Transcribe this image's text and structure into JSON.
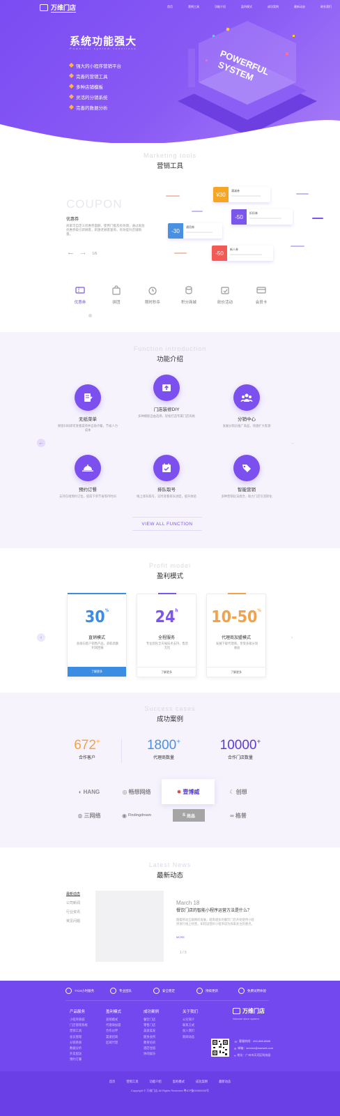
{
  "brand": {
    "name": "万维门店"
  },
  "nav": [
    "首页",
    "营销工具",
    "功能介绍",
    "盈利模式",
    "成功案例",
    "最新动态",
    "联系我们"
  ],
  "hero": {
    "title": "系统功能强大",
    "subtitle": "Powerful system functions",
    "features": [
      "强大的小程序营销平台",
      "完善的营销工具",
      "多种店铺模板",
      "灵活的分销系统",
      "完善的数据分析"
    ],
    "badge_line1": "POWERFUL",
    "badge_line2": "SYSTEM"
  },
  "marketing": {
    "en": "Marketing tools",
    "cn": "营销工具",
    "big": "COUPON",
    "name": "优惠券",
    "desc": "商家可自定义优惠券面额、使用门槛及有效期，通过发放优惠券吸引新顾客，刺激老顾客复购，有效提升店铺销量。",
    "pager": "1/6",
    "tickets": [
      {
        "value": "¥30",
        "label": "满减券",
        "color": "#f6a623"
      },
      {
        "value": "-50",
        "label": "折扣券",
        "color": "#7b55ec"
      },
      {
        "value": "-30",
        "label": "通用券",
        "color": "#4a90e2"
      },
      {
        "value": "-50",
        "label": "新人券",
        "color": "#f25a55"
      }
    ],
    "tabs": [
      "优惠券",
      "拼团",
      "限时秒杀",
      "积分商城",
      "砍价活动",
      "会员卡"
    ],
    "active_tab": 0
  },
  "functions": {
    "en": "Function introduction",
    "cn": "功能介绍",
    "items": [
      {
        "title": "无纸菜单",
        "desc": "顾客扫码即可查看菜单并自助点餐，节省人力成本"
      },
      {
        "title": "门店装修DIY",
        "desc": "多种模板自由选择，轻松打造专属门店风格"
      },
      {
        "title": "分销中心",
        "desc": "发展分销员推广商品，快速扩大客源"
      },
      {
        "title": "预约订餐",
        "desc": "支持在线预约订位，提前下单节省等待时间"
      },
      {
        "title": "排队取号",
        "desc": "线上排队取号，实时查看排队进度，提升体验"
      },
      {
        "title": "智能营销",
        "desc": "多种营销玩法组合，助力门店引流转化"
      }
    ],
    "view_all": "VIEW ALL FUNCTION"
  },
  "profit": {
    "en": "Profit model",
    "cn": "盈利模式",
    "cards": [
      {
        "num": "30",
        "sup": "%",
        "title": "直销模式",
        "desc": "直接向客户销售产品，获取高额利润回报",
        "btn": "了解更多",
        "color": "#3b8ce3"
      },
      {
        "num": "24",
        "sup": "h",
        "title": "全程服务",
        "desc": "专业团队全天候技术支持，售后无忧",
        "btn": "了解更多",
        "color": "#7b55ec"
      },
      {
        "num": "10-50",
        "sup": "%",
        "title": "代理商加盟模式",
        "desc": "发展下级代理商，享受多级分润收益",
        "btn": "了解更多",
        "color": "#f5a14a"
      }
    ]
  },
  "cases": {
    "en": "Success cases",
    "cn": "成功案例",
    "stats": [
      {
        "num": "672",
        "plus": "+",
        "label": "合作客户",
        "color": "#f5a14a"
      },
      {
        "num": "1800",
        "plus": "+",
        "label": "代理商数量",
        "color": "#4a90e2"
      },
      {
        "num": "10000",
        "plus": "+",
        "label": "合作门店数量",
        "color": "#5a3bd8"
      }
    ],
    "brands": [
      "HANG",
      "畅想网络",
      "壹博威",
      "创想",
      "三网络",
      "Findingdream",
      "尚品",
      "格普"
    ]
  },
  "news": {
    "en": "Latest News",
    "cn": "最新动态",
    "tabs": [
      "最新动态",
      "公司新闻",
      "行业资讯",
      "常见问题"
    ],
    "date": "March 18",
    "title": "餐饮门店的智能小程序运营方法是什么？",
    "body": "随着移动互联网的发展，越来越多的餐饮门店开始使用小程序进行线上经营，如何运营好小程序成为商家关注的重点。",
    "more": "MORE",
    "pager": "1 / 5"
  },
  "footer": {
    "features": [
      "7×24小时服务",
      "专业团队",
      "安全稳定",
      "持续更新",
      "免费试用体验"
    ],
    "columns": [
      {
        "head": "产品服务",
        "items": [
          "小程序商城",
          "门店管理系统",
          "营销工具",
          "会员管理",
          "分销系统",
          "数据分析",
          "外卖配送",
          "预约订餐"
        ]
      },
      {
        "head": "盈利模式",
        "items": [
          "直销模式",
          "代理商加盟",
          "合作伙伴",
          "渠道招商",
          "区域代理"
        ]
      },
      {
        "head": "成功案例",
        "items": [
          "餐饮门店",
          "零售门店",
          "美容美发",
          "健身会所",
          "教育培训",
          "酒店住宿",
          "休闲娱乐"
        ]
      },
      {
        "head": "关于我们",
        "items": [
          "公司简介",
          "联系方式",
          "加入我们",
          "新闻动态"
        ]
      }
    ],
    "brand": "万维门店",
    "tagline": "Wanwei store system",
    "contacts": [
      "客服热线：400-888-8888",
      "邮箱：service@wanwei.com",
      "地址：广州市天河区科技园"
    ],
    "links": [
      "首页",
      "营销工具",
      "功能介绍",
      "盈利模式",
      "成功案例",
      "最新动态"
    ],
    "copyright": "Copyright © 万维门店 All Rights Reserved  粤ICP备00000000号"
  }
}
